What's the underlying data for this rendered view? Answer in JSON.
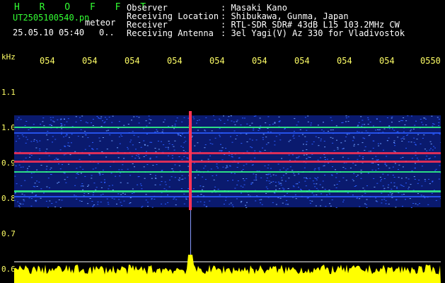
{
  "header": {
    "logo": "H R O F F T",
    "filename": "UT2505100540.pn",
    "type_label": "meteor",
    "datetime": "25.05.10 05:40",
    "extra": "0..",
    "fields": [
      {
        "label": "Observer",
        "value": ": Masaki Kano"
      },
      {
        "label": "Receiving Location",
        "value": ": Shibukawa, Gunma, Japan"
      },
      {
        "label": "Receiver",
        "value": ": RTL-SDR SDR# 43dB L15 103.2MHz CW"
      },
      {
        "label": "Receiving Antenna",
        "value": ": 3el Yagi(V) Az 330 for Vladivostok"
      }
    ]
  },
  "time_axis": [
    "054",
    "054",
    "054",
    "054",
    "054",
    "054",
    "054",
    "054",
    "054",
    "0550"
  ],
  "freq_axis": {
    "unit": "kHz",
    "ticks": [
      "1.1",
      "1.0",
      "0.9",
      "0.8",
      "0.7",
      "0.6"
    ]
  },
  "colors": {
    "header_text": "#33ff33",
    "axis_text": "#ffff66",
    "noise_dark": "#0a1a6e",
    "noise_mid": "#2a5cff",
    "signal_hot": "#ff3355",
    "signal_green": "#33ff88",
    "power_trace": "#ffff00"
  }
}
